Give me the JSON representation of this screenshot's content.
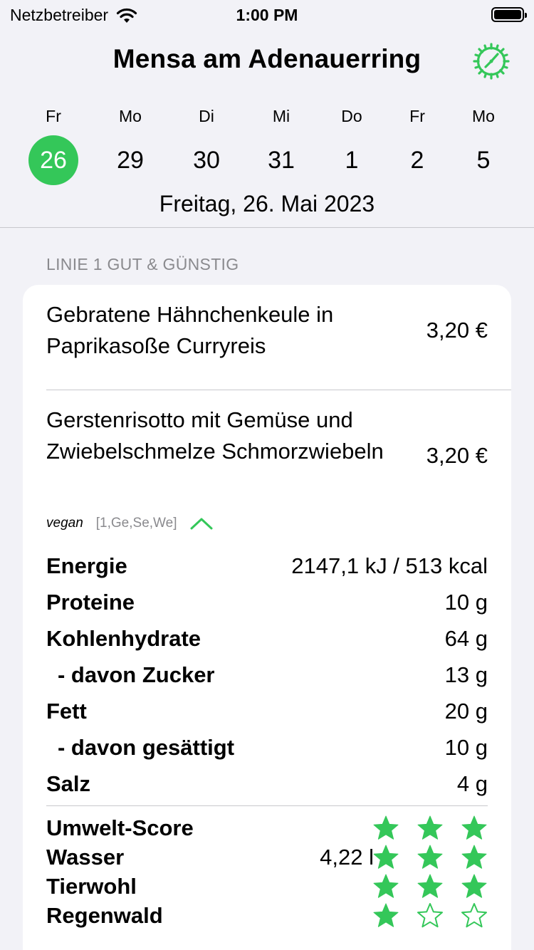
{
  "status": {
    "carrier": "Netzbetreiber",
    "time": "1:00 PM"
  },
  "header": {
    "title": "Mensa am Adenauerring",
    "days": [
      {
        "weekday": "Fr",
        "num": "26",
        "active": true
      },
      {
        "weekday": "Mo",
        "num": "29"
      },
      {
        "weekday": "Di",
        "num": "30"
      },
      {
        "weekday": "Mi",
        "num": "31"
      },
      {
        "weekday": "Do",
        "num": "1"
      },
      {
        "weekday": "Fr",
        "num": "2"
      },
      {
        "weekday": "Mo",
        "num": "5"
      }
    ],
    "date_label": "Freitag, 26. Mai 2023"
  },
  "section": {
    "title": "LINIE 1 GUT & GÜNSTIG"
  },
  "meals": [
    {
      "name": "Gebratene Hähnchenkeule in Paprikasoße Curryreis",
      "price": "3,20 €"
    },
    {
      "name": "Gerstenrisotto mit Gemüse und Zwiebelschmelze Schmorzwiebeln",
      "price": "3,20 €",
      "tag": "vegan",
      "allergens": "[1,Ge,Se,We]"
    }
  ],
  "nutrition": [
    {
      "label": "Energie",
      "value": "2147,1 kJ / 513 kcal"
    },
    {
      "label": "Proteine",
      "value": "10 g"
    },
    {
      "label": "Kohlenhydrate",
      "value": "64 g"
    },
    {
      "label": "- davon Zucker",
      "value": "13 g"
    },
    {
      "label": "Fett",
      "value": "20 g"
    },
    {
      "label": "- davon gesättigt",
      "value": "10 g"
    },
    {
      "label": "Salz",
      "value": "4 g"
    }
  ],
  "scores": [
    {
      "label": "Umwelt-Score",
      "value": "",
      "rating": 3
    },
    {
      "label": "Wasser",
      "value": "4,22 l",
      "rating": 3
    },
    {
      "label": "Tierwohl",
      "value": "",
      "rating": 3
    },
    {
      "label": "Regenwald",
      "value": "",
      "rating": 1
    }
  ],
  "colors": {
    "accent": "#34c759",
    "background": "#f2f2f7",
    "separator": "#c8c8cc",
    "secondary_text": "#8a8a8e"
  },
  "icons": {
    "settings": "gear-clock-icon",
    "wifi": "wifi-icon",
    "battery": "battery-icon",
    "collapse": "chevron-up-icon",
    "star_filled": "star-filled-icon",
    "star_empty": "star-outline-icon"
  }
}
